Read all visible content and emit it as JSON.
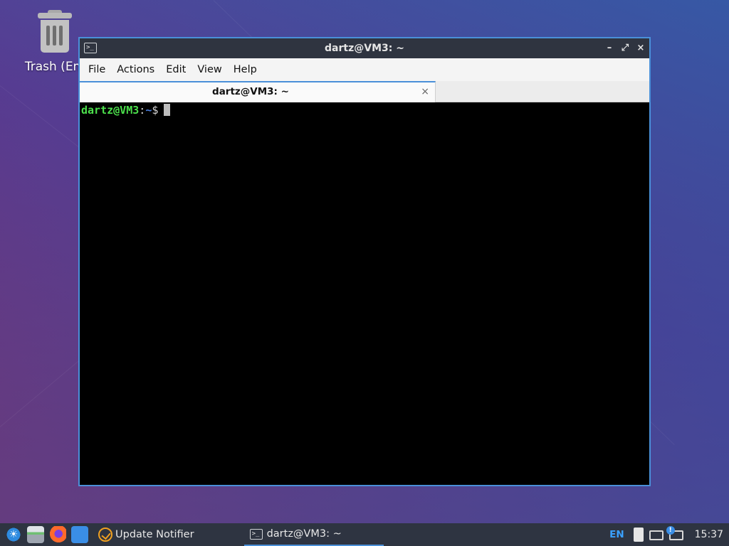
{
  "desktop": {
    "icons": [
      {
        "label": "Trash (Em",
        "icon": "trash-icon"
      }
    ]
  },
  "window": {
    "title": "dartz@VM3: ~",
    "app_icon": "terminal-icon",
    "controls": {
      "minimize": "–",
      "maximize": "⤢",
      "close": "×"
    },
    "menu": [
      "File",
      "Actions",
      "Edit",
      "View",
      "Help"
    ],
    "tabs": [
      {
        "label": "dartz@VM3: ~",
        "close": "×"
      }
    ],
    "terminal": {
      "prompt_user": "dartz@VM3",
      "prompt_sep": ":",
      "prompt_path": "~",
      "prompt_symbol": "$"
    }
  },
  "taskbar": {
    "launchers": [
      "start-menu-icon",
      "file-manager-icon",
      "firefox-icon",
      "show-desktop-icon"
    ],
    "tasks": [
      {
        "label": "Update Notifier",
        "icon": "update-notifier-icon"
      },
      {
        "label": "dartz@VM3: ~",
        "icon": "terminal-icon",
        "active": true
      }
    ],
    "tray": {
      "keyboard_layout": "EN",
      "icons": [
        "clipboard-icon",
        "network-icon",
        "update-alert-icon"
      ],
      "clock": "15:37"
    }
  },
  "colors": {
    "accent": "#4a90d9",
    "prompt_user": "#4ce04c",
    "prompt_path": "#4a7fe0",
    "titlebar": "#2f3440",
    "taskbar": "#2e3441"
  }
}
